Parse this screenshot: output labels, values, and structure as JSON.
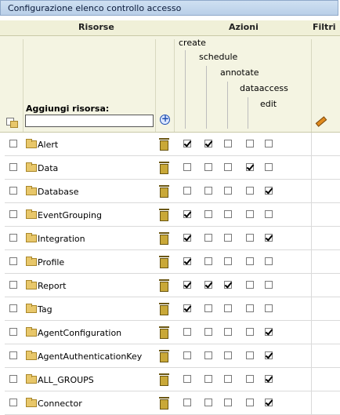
{
  "window": {
    "title": "Configurazione elenco controllo accesso"
  },
  "headers": {
    "resources": "Risorse",
    "actions": "Azioni",
    "filters": "Filtri"
  },
  "actions": [
    "create",
    "schedule",
    "annotate",
    "dataaccess",
    "edit"
  ],
  "add_resource": {
    "label": "Aggiungi risorsa:",
    "value": ""
  },
  "rows": [
    {
      "name": "Alert",
      "selected": false,
      "perms": [
        true,
        true,
        false,
        false,
        false
      ]
    },
    {
      "name": "Data",
      "selected": false,
      "perms": [
        false,
        false,
        false,
        true,
        false
      ]
    },
    {
      "name": "Database",
      "selected": false,
      "perms": [
        false,
        false,
        false,
        false,
        true
      ]
    },
    {
      "name": "EventGrouping",
      "selected": false,
      "perms": [
        true,
        false,
        false,
        false,
        false
      ]
    },
    {
      "name": "Integration",
      "selected": false,
      "perms": [
        true,
        false,
        false,
        false,
        true
      ]
    },
    {
      "name": "Profile",
      "selected": false,
      "perms": [
        true,
        false,
        false,
        false,
        false
      ]
    },
    {
      "name": "Report",
      "selected": false,
      "perms": [
        true,
        true,
        true,
        false,
        false
      ]
    },
    {
      "name": "Tag",
      "selected": false,
      "perms": [
        true,
        false,
        false,
        false,
        false
      ]
    },
    {
      "name": "AgentConfiguration",
      "selected": false,
      "perms": [
        false,
        false,
        false,
        false,
        true
      ]
    },
    {
      "name": "AgentAuthenticationKey",
      "selected": false,
      "perms": [
        false,
        false,
        false,
        false,
        true
      ]
    },
    {
      "name": "ALL_GROUPS",
      "selected": false,
      "perms": [
        false,
        false,
        false,
        false,
        true
      ]
    },
    {
      "name": "Connector",
      "selected": false,
      "perms": [
        false,
        false,
        false,
        false,
        true
      ]
    }
  ]
}
